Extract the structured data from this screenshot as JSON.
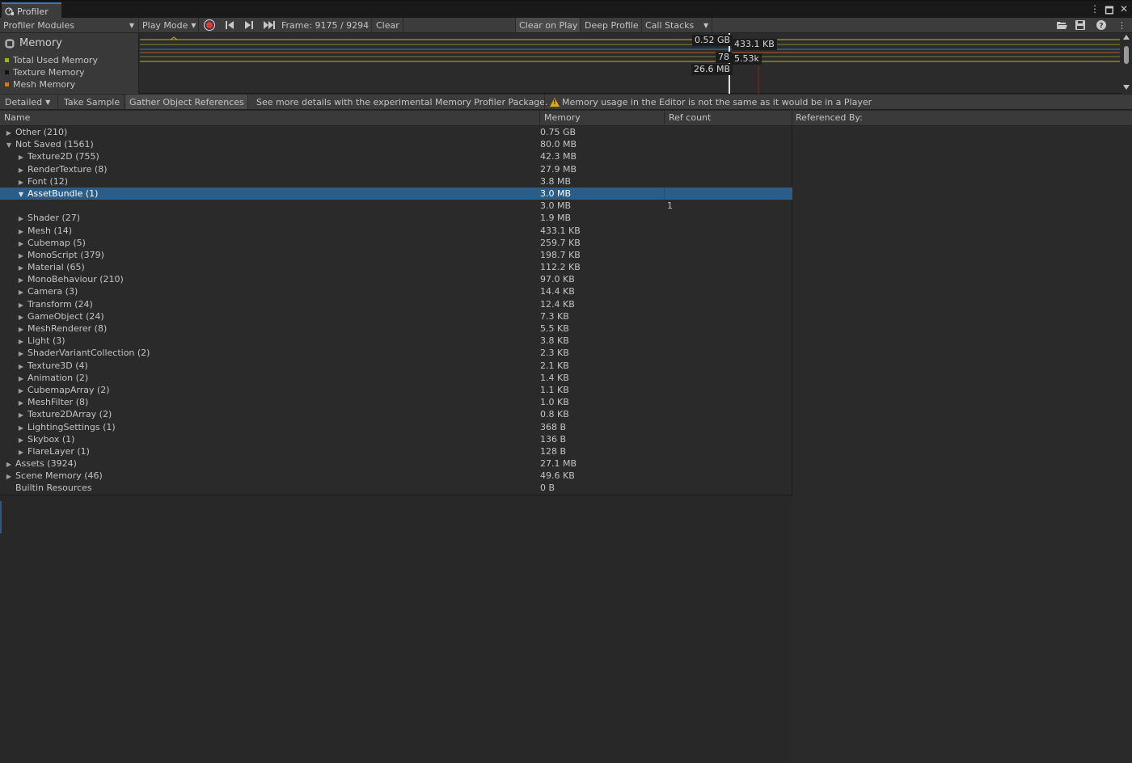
{
  "window": {
    "tab_title": "Profiler",
    "controls": [
      "⋮",
      "🗖",
      "✕"
    ]
  },
  "toolbar": {
    "modules_label": "Profiler Modules",
    "play_mode_label": "Play Mode",
    "frame_label": "Frame: 9175 / 9294",
    "clear_label": "Clear",
    "clear_on_play_label": "Clear on Play",
    "deep_profile_label": "Deep Profile",
    "call_stacks_label": "Call Stacks"
  },
  "module": {
    "title": "Memory",
    "legend": [
      {
        "label": "Total Used Memory",
        "color": "#9fb01e"
      },
      {
        "label": "Texture Memory",
        "color": "#111111"
      },
      {
        "label": "Mesh Memory",
        "color": "#d07a12"
      }
    ]
  },
  "chart_labels": {
    "total": "0.52 GB",
    "mesh": "433.1 KB",
    "small": "78",
    "objects": "5.53k",
    "texture": "26.6 MB"
  },
  "details_bar": {
    "view_label": "Detailed",
    "take_sample_label": "Take Sample",
    "gather_label": "Gather Object References",
    "info_label": "See more details with the experimental Memory Profiler Package.",
    "warning_label": "Memory usage in the Editor is not the same as it would be in a Player"
  },
  "tree": {
    "columns": {
      "name": "Name",
      "memory": "Memory",
      "ref_count": "Ref count"
    },
    "rows": [
      {
        "name": "Other (210)",
        "memory": "0.75 GB",
        "ref": "",
        "depth": 0,
        "arrow": "right"
      },
      {
        "name": "Not Saved (1561)",
        "memory": "80.0 MB",
        "ref": "",
        "depth": 0,
        "arrow": "down"
      },
      {
        "name": "Texture2D (755)",
        "memory": "42.3 MB",
        "ref": "",
        "depth": 1,
        "arrow": "right"
      },
      {
        "name": "RenderTexture (8)",
        "memory": "27.9 MB",
        "ref": "",
        "depth": 1,
        "arrow": "right"
      },
      {
        "name": "Font (12)",
        "memory": "3.8 MB",
        "ref": "",
        "depth": 1,
        "arrow": "right"
      },
      {
        "name": "AssetBundle (1)",
        "memory": "3.0 MB",
        "ref": "",
        "depth": 1,
        "arrow": "down",
        "selected": true
      },
      {
        "name": "",
        "memory": "3.0 MB",
        "ref": "1",
        "depth": 2,
        "arrow": "none"
      },
      {
        "name": "Shader (27)",
        "memory": "1.9 MB",
        "ref": "",
        "depth": 1,
        "arrow": "right"
      },
      {
        "name": "Mesh (14)",
        "memory": "433.1 KB",
        "ref": "",
        "depth": 1,
        "arrow": "right"
      },
      {
        "name": "Cubemap (5)",
        "memory": "259.7 KB",
        "ref": "",
        "depth": 1,
        "arrow": "right"
      },
      {
        "name": "MonoScript (379)",
        "memory": "198.7 KB",
        "ref": "",
        "depth": 1,
        "arrow": "right"
      },
      {
        "name": "Material (65)",
        "memory": "112.2 KB",
        "ref": "",
        "depth": 1,
        "arrow": "right"
      },
      {
        "name": "MonoBehaviour (210)",
        "memory": "97.0 KB",
        "ref": "",
        "depth": 1,
        "arrow": "right"
      },
      {
        "name": "Camera (3)",
        "memory": "14.4 KB",
        "ref": "",
        "depth": 1,
        "arrow": "right"
      },
      {
        "name": "Transform (24)",
        "memory": "12.4 KB",
        "ref": "",
        "depth": 1,
        "arrow": "right"
      },
      {
        "name": "GameObject (24)",
        "memory": "7.3 KB",
        "ref": "",
        "depth": 1,
        "arrow": "right"
      },
      {
        "name": "MeshRenderer (8)",
        "memory": "5.5 KB",
        "ref": "",
        "depth": 1,
        "arrow": "right"
      },
      {
        "name": "Light (3)",
        "memory": "3.8 KB",
        "ref": "",
        "depth": 1,
        "arrow": "right"
      },
      {
        "name": "ShaderVariantCollection (2)",
        "memory": "2.3 KB",
        "ref": "",
        "depth": 1,
        "arrow": "right"
      },
      {
        "name": "Texture3D (4)",
        "memory": "2.1 KB",
        "ref": "",
        "depth": 1,
        "arrow": "right"
      },
      {
        "name": "Animation (2)",
        "memory": "1.4 KB",
        "ref": "",
        "depth": 1,
        "arrow": "right"
      },
      {
        "name": "CubemapArray (2)",
        "memory": "1.1 KB",
        "ref": "",
        "depth": 1,
        "arrow": "right"
      },
      {
        "name": "MeshFilter (8)",
        "memory": "1.0 KB",
        "ref": "",
        "depth": 1,
        "arrow": "right"
      },
      {
        "name": "Texture2DArray (2)",
        "memory": "0.8 KB",
        "ref": "",
        "depth": 1,
        "arrow": "right"
      },
      {
        "name": "LightingSettings (1)",
        "memory": "368 B",
        "ref": "",
        "depth": 1,
        "arrow": "right"
      },
      {
        "name": "Skybox (1)",
        "memory": "136 B",
        "ref": "",
        "depth": 1,
        "arrow": "right"
      },
      {
        "name": "FlareLayer (1)",
        "memory": "128 B",
        "ref": "",
        "depth": 1,
        "arrow": "right"
      },
      {
        "name": "Assets (3924)",
        "memory": "27.1 MB",
        "ref": "",
        "depth": 0,
        "arrow": "right"
      },
      {
        "name": "Scene Memory (46)",
        "memory": "49.6 KB",
        "ref": "",
        "depth": 0,
        "arrow": "right"
      },
      {
        "name": "Builtin Resources",
        "memory": "0 B",
        "ref": "",
        "depth": 0,
        "arrow": "none"
      }
    ]
  },
  "referenced_by": {
    "header": "Referenced By:"
  }
}
